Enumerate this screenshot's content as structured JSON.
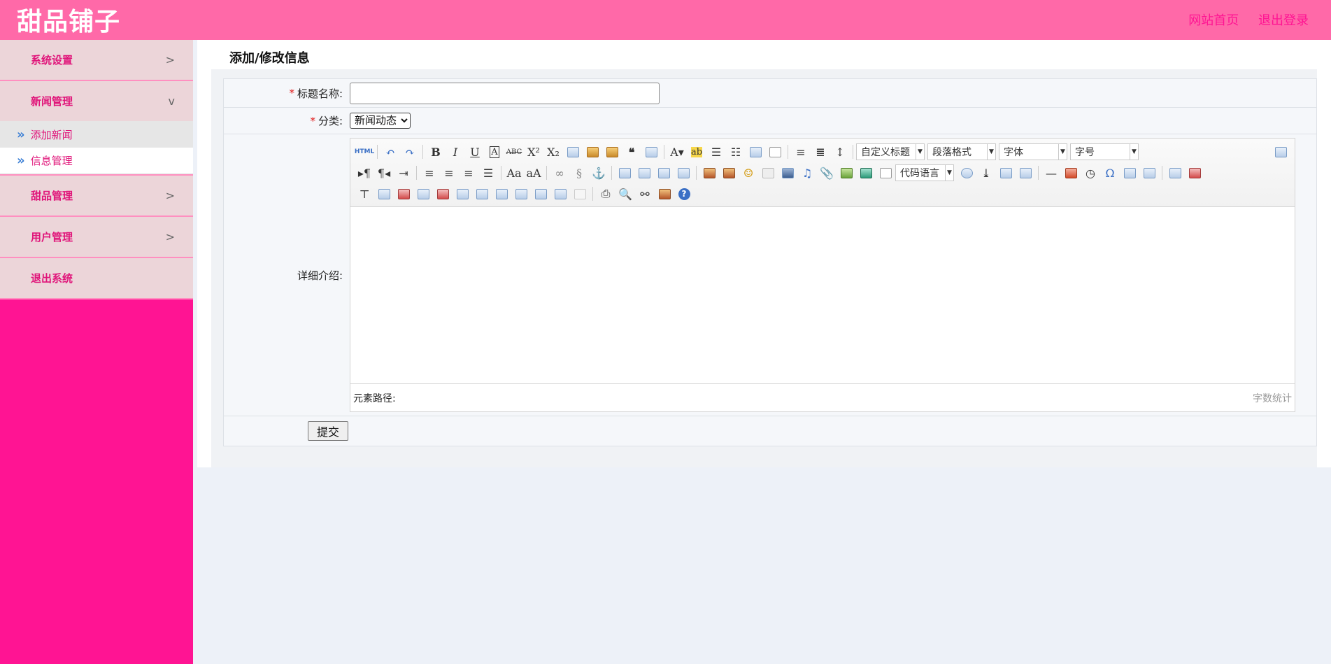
{
  "app": {
    "brand": "甜品铺子"
  },
  "header": {
    "links": [
      "网站首页",
      "退出登录"
    ]
  },
  "sidebar": {
    "groups": [
      {
        "label": "系统设置",
        "arrow": ">"
      },
      {
        "label": "新闻管理",
        "arrow": "v",
        "items": [
          "添加新闻",
          "信息管理"
        ]
      },
      {
        "label": "甜品管理",
        "arrow": ">"
      },
      {
        "label": "用户管理",
        "arrow": ">"
      },
      {
        "label": "退出系统",
        "arrow": ""
      }
    ]
  },
  "panel": {
    "title": "添加/修改信息"
  },
  "form": {
    "title_label": "标题名称:",
    "title_value": "",
    "category_label": "分类:",
    "category_value": "新闻动态",
    "detail_label": "详细介绍:",
    "required_mark": "*",
    "submit_label": "提交"
  },
  "editor": {
    "dropdowns": {
      "custom_title": "自定义标题",
      "paragraph": "段落格式",
      "font": "字体",
      "size": "字号",
      "code_lang": "代码语言"
    },
    "html_button": "HTML",
    "path_label": "元素路径:",
    "word_count": "字数统计"
  }
}
